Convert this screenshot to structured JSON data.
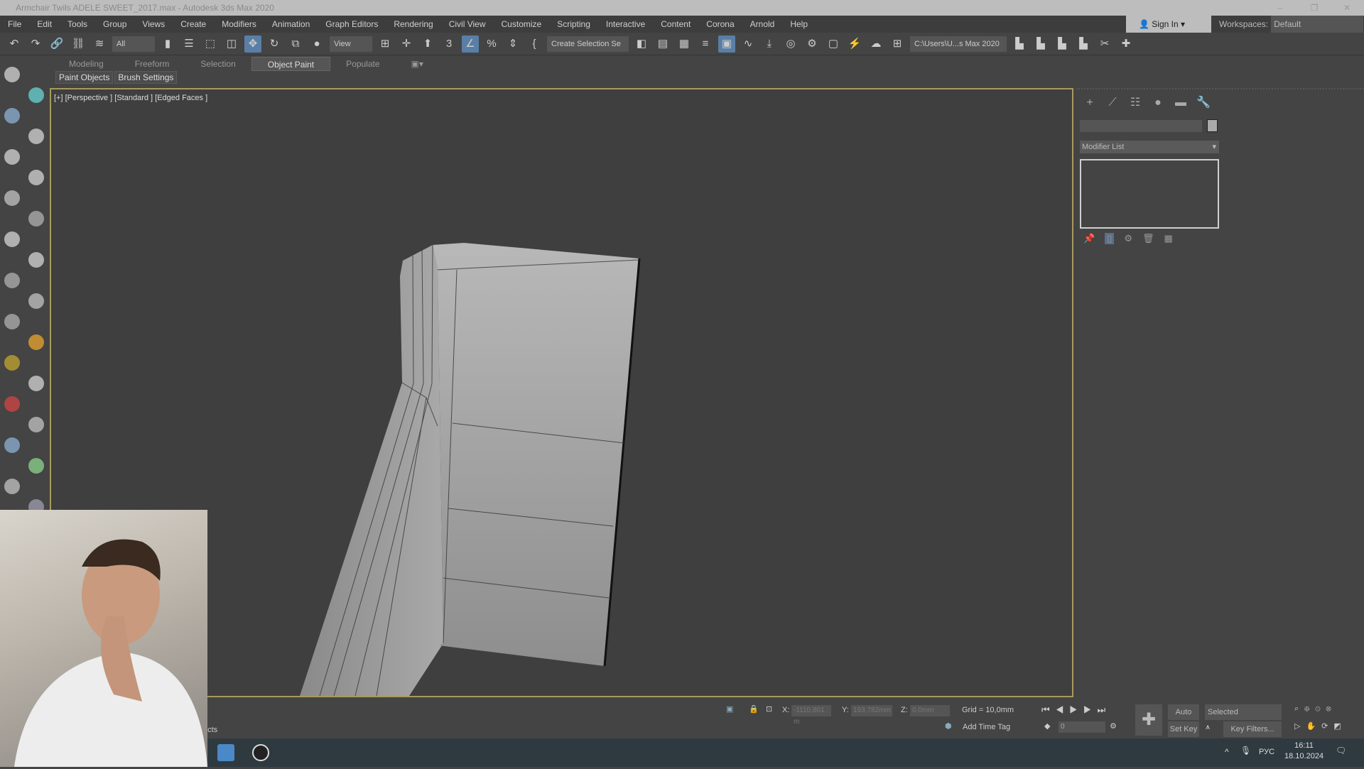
{
  "window": {
    "title": "Armchair Twils ADELE SWEET_2017.max - Autodesk 3ds Max 2020"
  },
  "menu": [
    "File",
    "Edit",
    "Tools",
    "Group",
    "Views",
    "Create",
    "Modifiers",
    "Animation",
    "Graph Editors",
    "Rendering",
    "Civil View",
    "Customize",
    "Scripting",
    "Interactive",
    "Content",
    "Corona",
    "Arnold",
    "Help"
  ],
  "account": {
    "sign_in": "Sign In",
    "workspaces_label": "Workspaces:",
    "workspace": "Default"
  },
  "toolbar": {
    "filter": "All",
    "ref_coord": "View",
    "selection_set": "Create Selection Se",
    "project_path": "C:\\Users\\U...s Max 2020"
  },
  "ribbon": {
    "tabs": [
      "Modeling",
      "Freeform",
      "Selection",
      "Object Paint",
      "Populate"
    ],
    "active": "Object Paint",
    "sub": [
      "Paint Objects",
      "Brush Settings"
    ]
  },
  "viewport": {
    "label": "[+] [Perspective ] [Standard ] [Edged Faces ]",
    "accent": "#a79a5c"
  },
  "command_panel": {
    "modifier_list": "Modifier List"
  },
  "status": {
    "x_label": "X:",
    "x": "-1110,801 m",
    "y_label": "Y:",
    "y": "193,782mm",
    "z_label": "Z:",
    "z": "0,0mm",
    "grid": "Grid = 10,0mm",
    "add_time_tag": "Add Time Tag",
    "frame": "0",
    "auto_key": "Auto Key",
    "set_key": "Set Key",
    "key_mode": "Selected",
    "key_filters": "Key Filters...",
    "prompt": "ects"
  },
  "taskbar": {
    "lang": "РУС",
    "time": "16:11",
    "date": "18.10.2024"
  }
}
